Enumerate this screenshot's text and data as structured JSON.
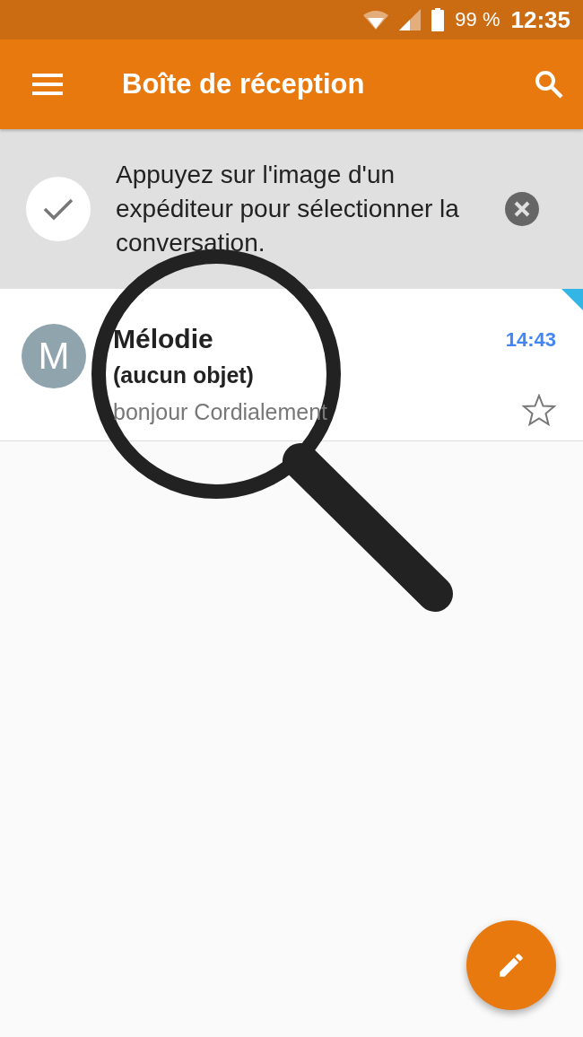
{
  "status_bar": {
    "battery": "99 %",
    "time": "12:35"
  },
  "app_bar": {
    "title": "Boîte de réception"
  },
  "tip": {
    "text": "Appuyez sur l'image d'un expéditeur pour sélectionner la conversation."
  },
  "messages": [
    {
      "avatar": "M",
      "sender": "Mélodie",
      "subject": "(aucun objet)",
      "snippet": "bonjour Cordialement",
      "time": "14:43",
      "unread": true,
      "starred": false
    }
  ]
}
